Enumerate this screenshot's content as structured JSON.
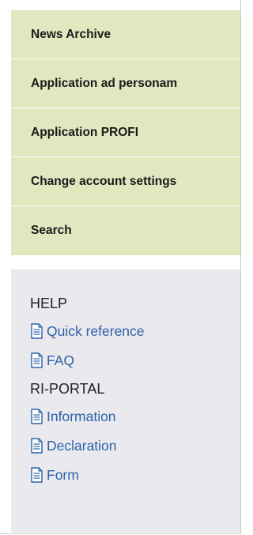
{
  "nav": {
    "items": [
      {
        "label": "News Archive"
      },
      {
        "label": "Application ad personam"
      },
      {
        "label": "Application PROFI"
      },
      {
        "label": "Change account settings"
      },
      {
        "label": "Search"
      }
    ]
  },
  "help": {
    "title": "HELP",
    "links": [
      {
        "label": "Quick reference",
        "icon": "document-icon"
      },
      {
        "label": "FAQ",
        "icon": "document-icon"
      }
    ]
  },
  "portal": {
    "title": "RI-PORTAL",
    "links": [
      {
        "label": "Information",
        "icon": "document-icon"
      },
      {
        "label": "Declaration",
        "icon": "document-icon"
      },
      {
        "label": "Form",
        "icon": "document-icon"
      }
    ]
  },
  "colors": {
    "nav_background": "#dfe8bf",
    "help_background": "#e9e9ee",
    "link_color": "#2e63a8"
  }
}
